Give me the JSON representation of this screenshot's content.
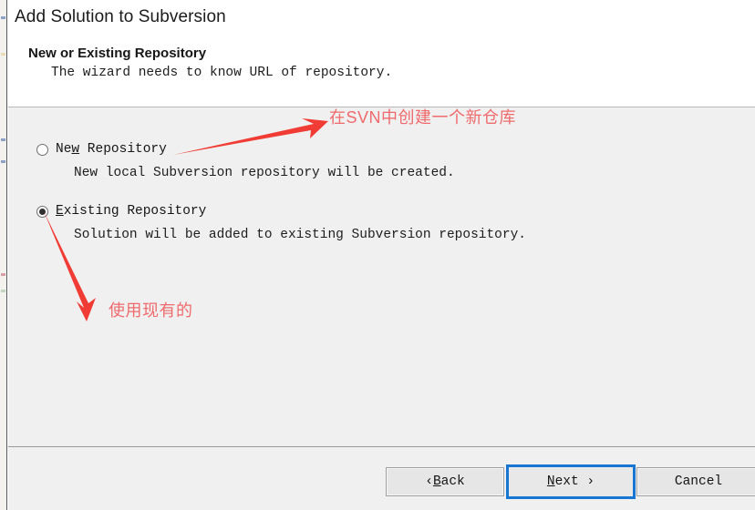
{
  "window": {
    "title": "Add Solution to Subversion"
  },
  "header": {
    "heading": "New or Existing Repository",
    "subtext": "The wizard needs to know URL of repository."
  },
  "options": [
    {
      "id": "new-repository",
      "label_before": "Ne",
      "label_accel": "w",
      "label_after": " Repository",
      "description": "New local Subversion repository will be created.",
      "selected": false
    },
    {
      "id": "existing-repository",
      "label_before": "",
      "label_accel": "E",
      "label_after": "xisting Repository",
      "description": "Solution will be added to existing Subversion repository.",
      "selected": true
    }
  ],
  "annotations": [
    {
      "id": "new-repository-note",
      "text": "在SVN中创建一个新仓库"
    },
    {
      "id": "existing-repository-note",
      "text": "使用现有的"
    }
  ],
  "footer": {
    "back": {
      "prefix": "‹ ",
      "accel": "B",
      "suffix": "ack"
    },
    "next": {
      "accel": "N",
      "suffix": "ext ›"
    },
    "cancel": {
      "label": "Cancel"
    }
  },
  "colors": {
    "annotation_red": "#ee6a6d",
    "arrow_red": "#f03c34",
    "focus_blue": "#1776d2",
    "dialog_background": "#f0f0f0",
    "header_background": "#ffffff"
  }
}
